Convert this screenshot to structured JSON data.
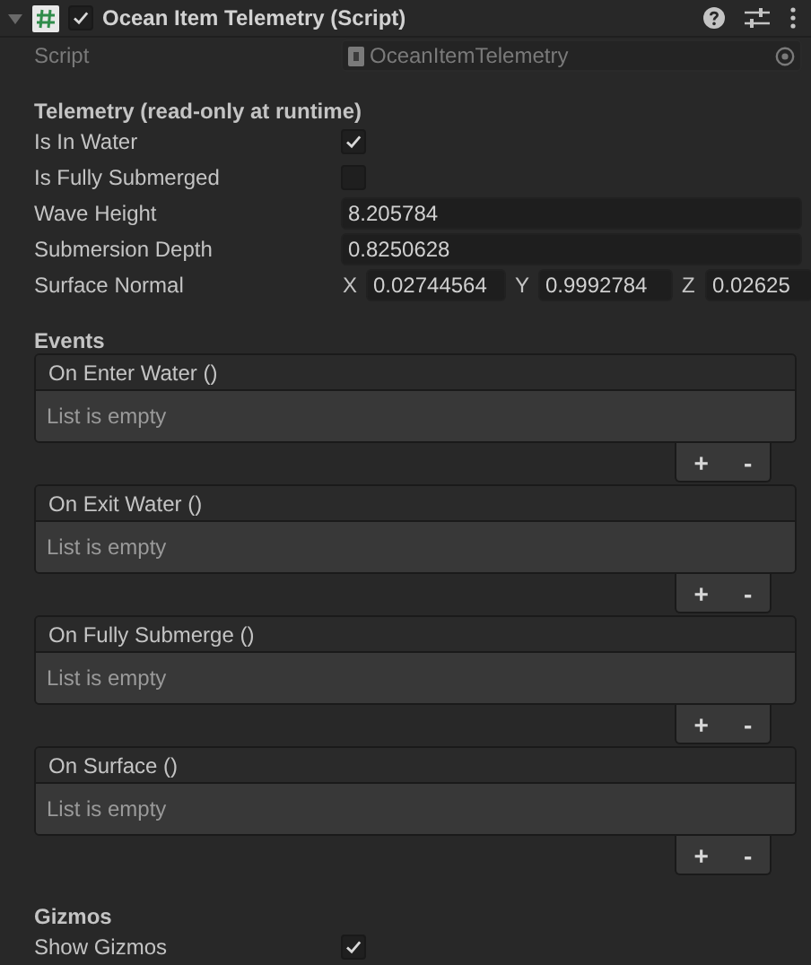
{
  "component": {
    "title": "Ocean Item Telemetry (Script)",
    "expanded": true,
    "enabled": true
  },
  "script": {
    "label": "Script",
    "value": "OceanItemTelemetry"
  },
  "sections": [
    {
      "title": "Telemetry (read-only at runtime)",
      "items": [
        {
          "kind": "toggle",
          "label": "Is In Water",
          "checked": true
        },
        {
          "kind": "toggle",
          "label": "Is Fully Submerged",
          "checked": false
        },
        {
          "kind": "number",
          "label": "Wave Height",
          "value": "8.205784"
        },
        {
          "kind": "number",
          "label": "Submersion Depth",
          "value": "0.8250628"
        },
        {
          "kind": "vector",
          "label": "Surface Normal",
          "components": [
            {
              "axis": "X",
              "value": "0.02744564"
            },
            {
              "axis": "Y",
              "value": "0.9992784"
            },
            {
              "axis": "Z",
              "value": "0.02625"
            }
          ]
        }
      ]
    },
    {
      "title": "Events",
      "items": [
        {
          "kind": "event",
          "name": "On Enter Water ()",
          "empty_text": "List is empty",
          "add": "+",
          "remove": "-"
        },
        {
          "kind": "event",
          "name": "On Exit Water ()",
          "empty_text": "List is empty",
          "add": "+",
          "remove": "-"
        },
        {
          "kind": "event",
          "name": "On Fully Submerge ()",
          "empty_text": "List is empty",
          "add": "+",
          "remove": "-"
        },
        {
          "kind": "event",
          "name": "On Surface ()",
          "empty_text": "List is empty",
          "add": "+",
          "remove": "-"
        }
      ]
    },
    {
      "title": "Gizmos",
      "items": [
        {
          "kind": "toggle",
          "label": "Show Gizmos",
          "checked": true
        }
      ]
    }
  ]
}
